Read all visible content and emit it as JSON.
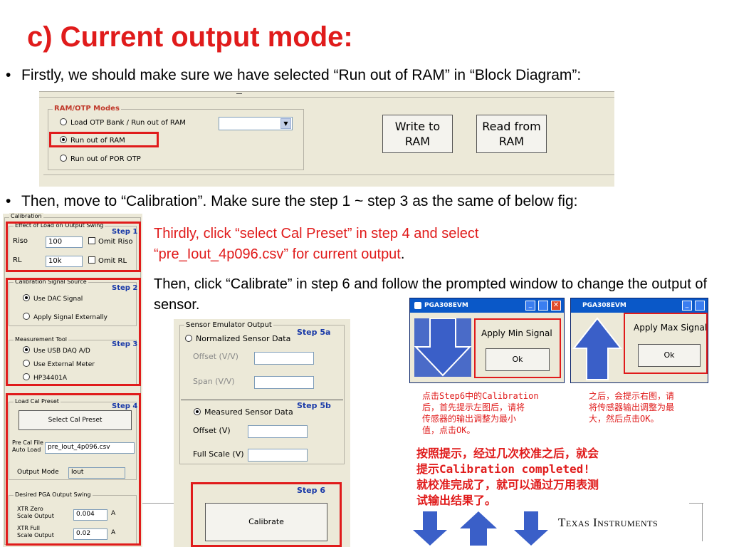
{
  "title": "c) Current output mode:",
  "bullets": {
    "first": "Firstly, we should make sure we have selected “Run out of RAM” in “Block Diagram”:",
    "second": "Then, move to “Calibration”. Make sure the step 1 ~ step 3 as the same of below fig:"
  },
  "ram_panel": {
    "group_title": "RAM/OTP Modes",
    "options": [
      "Load OTP Bank / Run out of RAM",
      "Run out of RAM",
      "Run out of POR OTP"
    ],
    "write_button": "Write to RAM",
    "read_button": "Read from RAM"
  },
  "notes": {
    "third_part1": "Thirdly, click “select Cal Preset” in step 4 and select “pre_Iout_4p096.csv” for current output",
    "third_period": ".",
    "then": "Then,  click “Calibrate” in step 6 and follow the prompted window to change the output of sensor."
  },
  "calibration": {
    "group": "Calibration",
    "effect_group": "Effect of Load on Output Swing",
    "step1": "Step 1",
    "riso_label": "Riso",
    "riso_value": "100",
    "omit_riso": "Omit Riso",
    "rl_label": "RL",
    "rl_value": "10k",
    "omit_rl": "Omit RL",
    "signal_source_group": "Calibration Signal Source",
    "step2": "Step 2",
    "use_dac": "Use DAC Signal",
    "apply_ext": "Apply Signal Externally",
    "measurement_group": "Measurement Tool",
    "step3": "Step 3",
    "use_usb": "Use USB DAQ A/D",
    "use_ext_meter": "Use External Meter",
    "hp": "HP34401A",
    "load_cal_group": "Load Cal Preset",
    "step4": "Step 4",
    "select_cal_preset": "Select Cal Preset",
    "pre_cal_label1": "Pre Cal File",
    "pre_cal_label2": "Auto Load",
    "pre_cal_value": "pre_Iout_4p096.csv",
    "output_mode_label": "Output Mode",
    "output_mode_value": "Iout",
    "desired_group": "Desired PGA Output Swing",
    "xtr_zero_1": "XTR Zero",
    "xtr_zero_2": "Scale Output",
    "xtr_zero_value": "0.004",
    "xtr_full_1": "XTR Full",
    "xtr_full_2": "Scale Output",
    "xtr_full_value": "0.02",
    "unit": "A"
  },
  "emulator": {
    "group": "Sensor Emulator Output",
    "normalized": "Normalized Sensor Data",
    "step5a": "Step 5a",
    "offset_vv": "Offset (V/V)",
    "span_vv": "Span (V/V)",
    "measured": "Measured Sensor Data",
    "step5b": "Step 5b",
    "offset_v": "Offset (V)",
    "full_scale_v": "Full Scale (V)",
    "step6": "Step 6",
    "calibrate": "Calibrate"
  },
  "dialogs": {
    "app_title": "PGA308EVM",
    "min_text": "Apply Min Signal",
    "max_text": "Apply Max Signal",
    "ok": "Ok"
  },
  "chinese_notes": {
    "left": [
      "点击Step6中的Calibration",
      "后，首先提示左图后，请将",
      "传感器的输出调整为最小",
      "值，点击OK。"
    ],
    "right": [
      "之后，会提示右图，请",
      "将传感器输出调整为最",
      "大，然后点击OK。"
    ],
    "bottom": [
      "按照提示，经过几次校准之后，就会",
      "提示Calibration completed!",
      "就校准完成了，就可以通过万用表测",
      "试输出结果了。"
    ]
  },
  "footer": {
    "logo": "Texas Instruments"
  },
  "colors": {
    "title_red": "#e01b1b",
    "arrow_blue": "#3a5fc8",
    "step_blue": "#1a3aa8",
    "panel_gray": "#ece9d8"
  }
}
